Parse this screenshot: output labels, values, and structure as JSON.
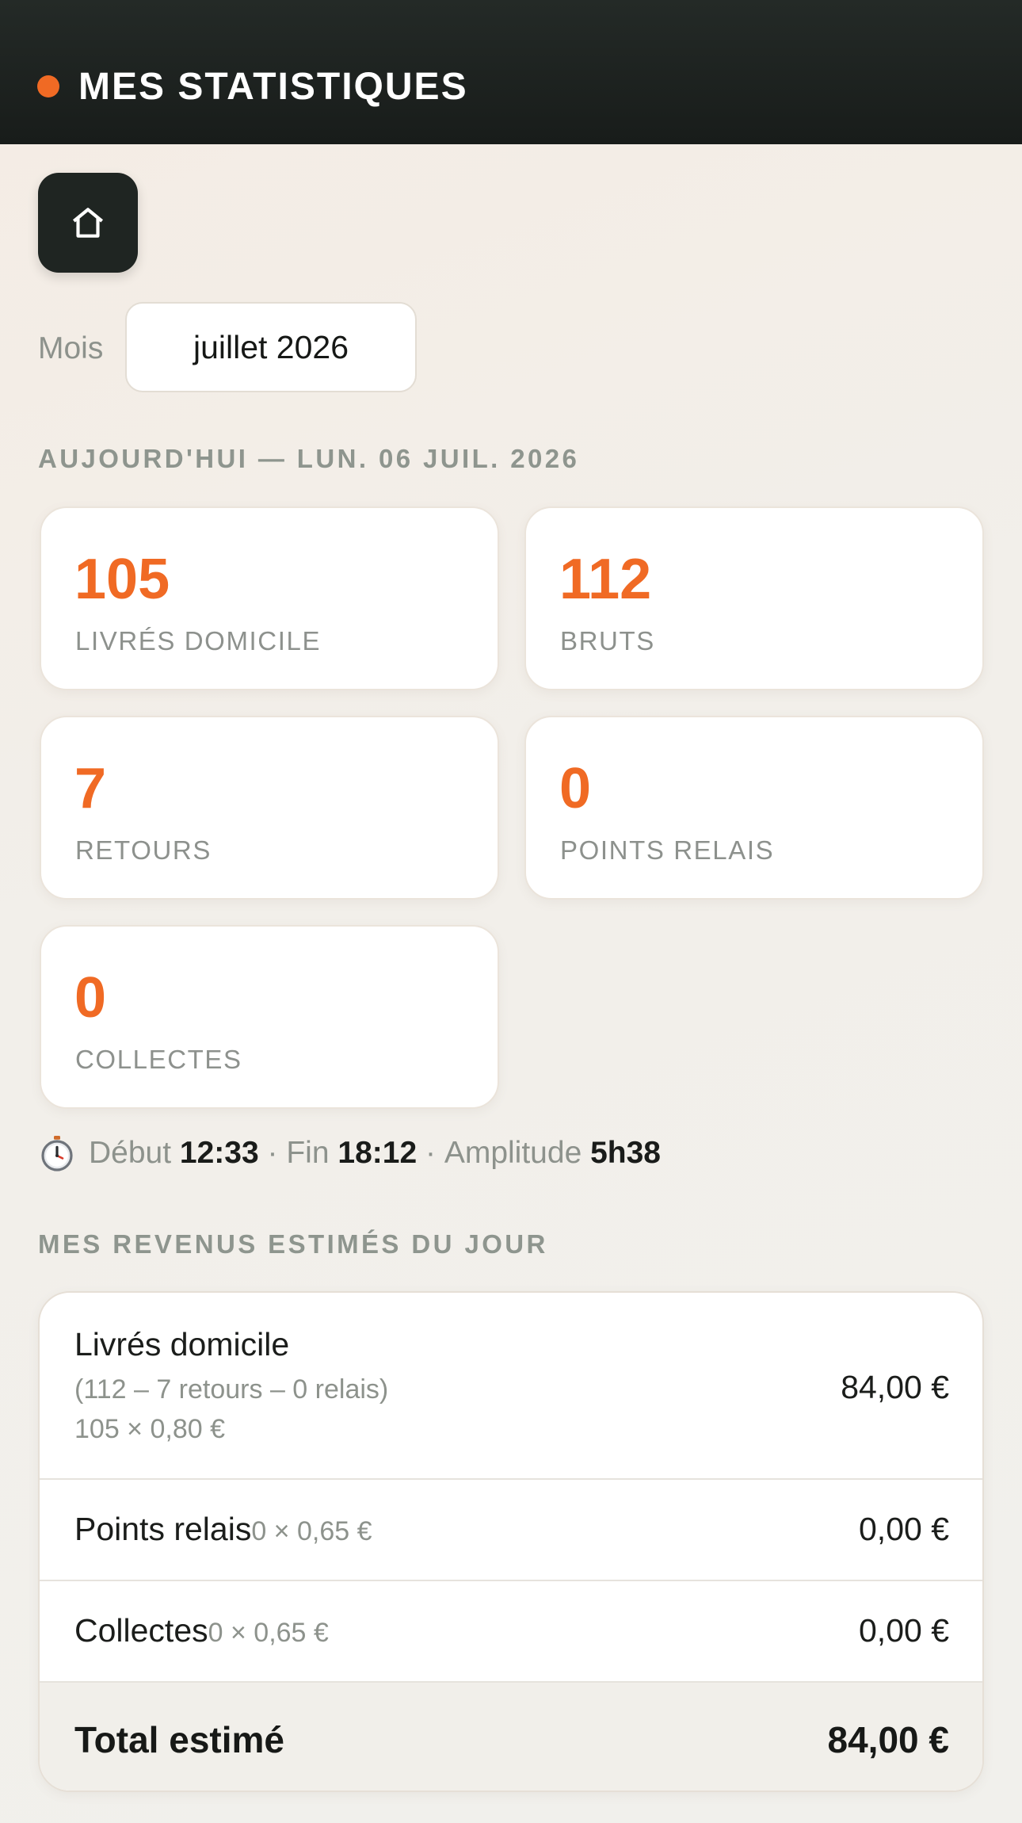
{
  "header": {
    "title": "MES STATISTIQUES",
    "dot_color": "#f06a24",
    "background": "#1c211f"
  },
  "home_button": {
    "icon": "home-icon"
  },
  "month_picker": {
    "label": "Mois",
    "value": "juillet 2026"
  },
  "today_section": {
    "title": "AUJOURD'HUI — LUN. 06 JUIL. 2026",
    "stats": [
      {
        "value": "105",
        "label": "LIVRÉS DOMICILE"
      },
      {
        "value": "112",
        "label": "BRUTS"
      },
      {
        "value": "7",
        "label": "RETOURS"
      },
      {
        "value": "0",
        "label": "POINTS RELAIS"
      },
      {
        "value": "0",
        "label": "COLLECTES"
      }
    ],
    "accent_color": "#f06a24"
  },
  "timing": {
    "icon": "stopwatch-icon",
    "start_label": "Début",
    "start_value": "12:33",
    "sep1": "·",
    "end_label": "Fin",
    "end_value": "18:12",
    "sep2": "·",
    "amplitude_label": "Amplitude",
    "amplitude_value": "5h38"
  },
  "revenue": {
    "title": "MES REVENUS ESTIMÉS DU JOUR",
    "rows": [
      {
        "label": "Livrés domicile",
        "detail": "(112 – 7 retours – 0 relais)",
        "calc": "105 × 0,80 €",
        "amount": "84,00 €"
      },
      {
        "label": "Points relais",
        "calc": "0 × 0,65 €",
        "amount": "0,00 €"
      },
      {
        "label": "Collectes",
        "calc": "0 × 0,65 €",
        "amount": "0,00 €"
      }
    ],
    "total_label": "Total estimé",
    "total_amount": "84,00 €"
  }
}
